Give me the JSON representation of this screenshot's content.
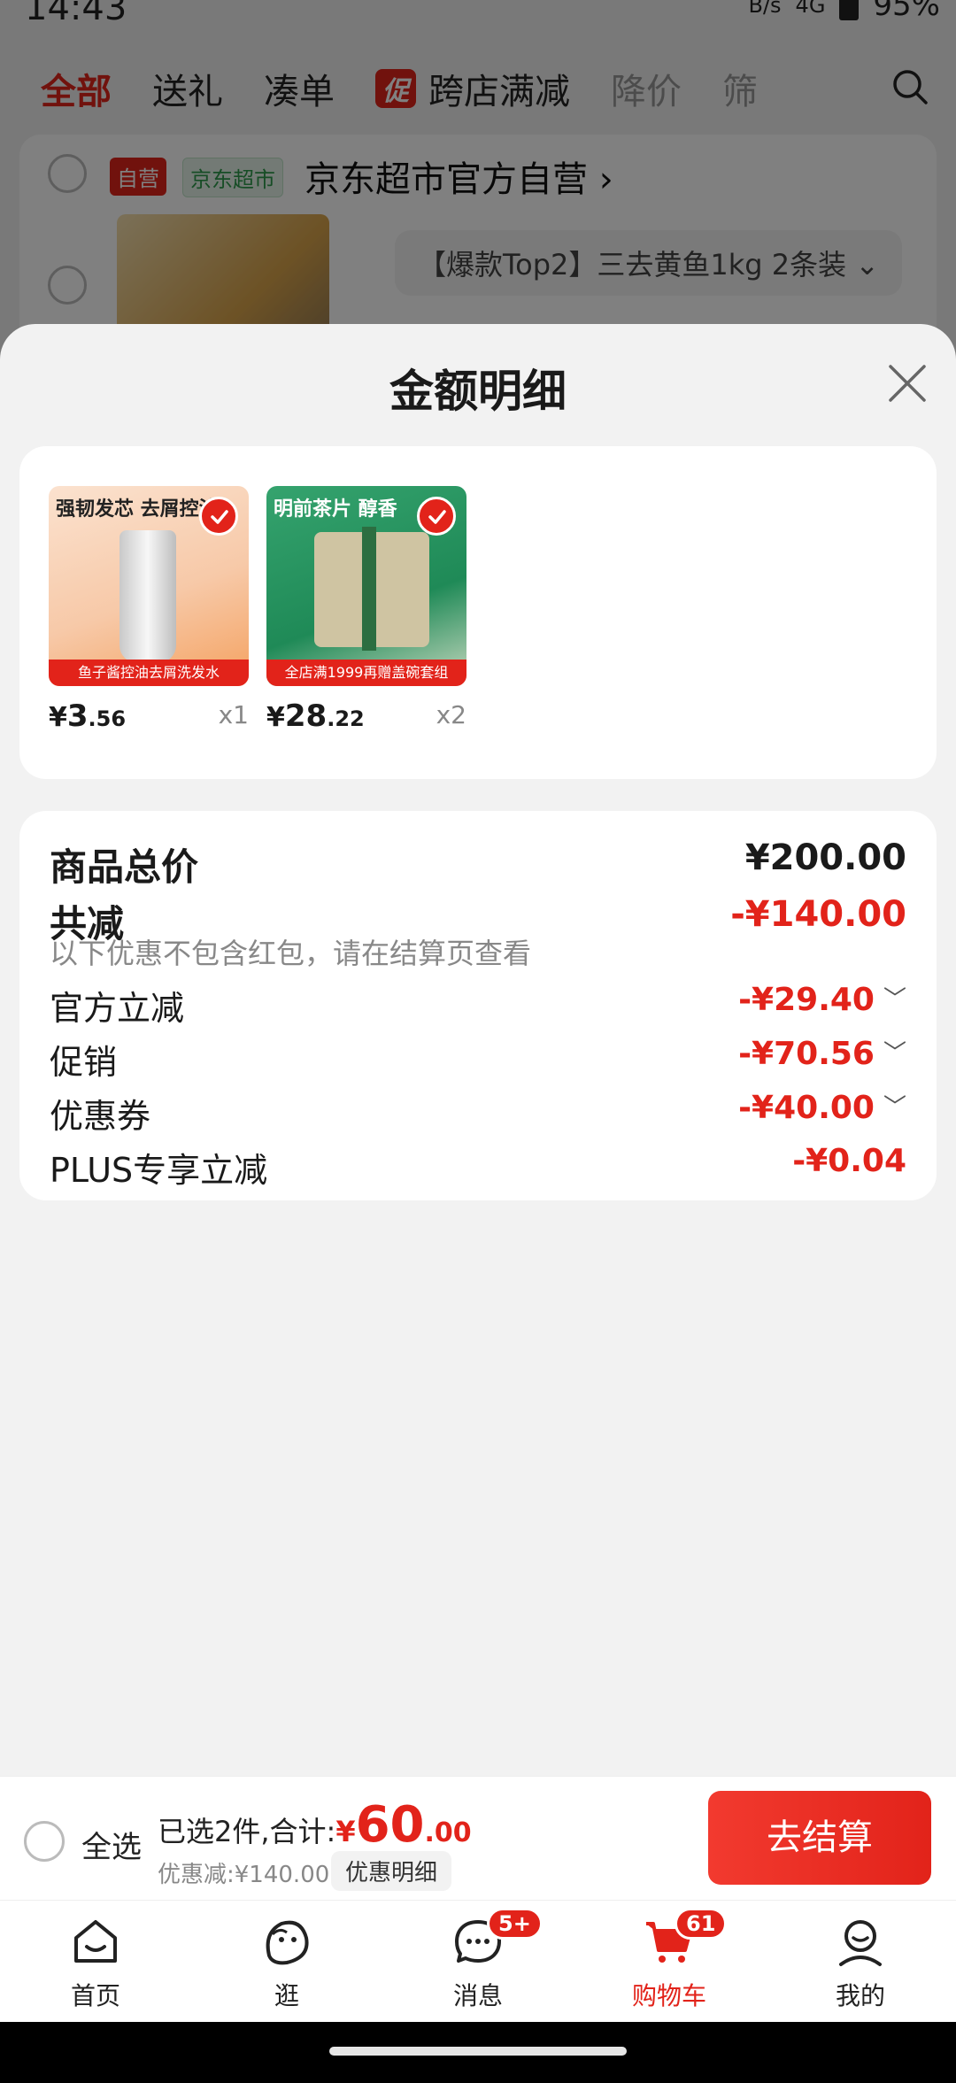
{
  "status_bar": {
    "time": "14:43",
    "net_speed": "B/s",
    "network": "4G",
    "battery": "95%"
  },
  "filter_tabs": [
    {
      "label": "全部"
    },
    {
      "label": "送礼"
    },
    {
      "label": "凑单"
    },
    {
      "badge": "促",
      "label": "跨店满减"
    },
    {
      "label": "降价"
    },
    {
      "label": "筛"
    }
  ],
  "shop": {
    "tag_self": "自营",
    "tag_market": "京东超市",
    "name": "京东超市官方自营 ›",
    "sku_text": "【爆款Top2】三去黄鱼1kg 2条装 ⌄"
  },
  "modal": {
    "title": "金额明细",
    "products": [
      {
        "headline": "强韧发芯 去屑控油",
        "foot_text": "鱼子酱控油去屑洗发水",
        "price_yen": "¥",
        "price_int": "3",
        "price_dec": ".56",
        "qty": "x1"
      },
      {
        "headline": "明前茶片 醇香",
        "foot_text": "全店满1999再赠盖碗套组",
        "price_yen": "¥",
        "price_int": "28",
        "price_dec": ".22",
        "qty": "x2"
      }
    ],
    "summary": {
      "total_label": "商品总价",
      "total_value": "¥200.00",
      "reduce_label": "共减",
      "reduce_value": "-¥140.00",
      "note": "以下优惠不包含红包，请在结算页查看",
      "items": [
        {
          "label": "官方立减",
          "value": "-¥29.40",
          "has_chevron": true
        },
        {
          "label": "促销",
          "value": "-¥70.56",
          "has_chevron": true
        },
        {
          "label": "优惠券",
          "value": "-¥40.00",
          "has_chevron": true
        },
        {
          "label": "PLUS专享立减",
          "value": "-¥0.04",
          "has_chevron": false
        }
      ]
    }
  },
  "settle": {
    "select_all": "全选",
    "selected_prefix": "已选2件,合计:",
    "total_yen": "¥",
    "total_int": "60",
    "total_dec": ".00",
    "discount": "优惠减:¥140.00",
    "detail_chip": "优惠明细",
    "checkout": "去结算"
  },
  "tabbar": [
    {
      "label": "首页",
      "icon": "home-icon"
    },
    {
      "label": "逛",
      "icon": "browse-icon"
    },
    {
      "label": "消息",
      "icon": "message-icon",
      "badge": "5+"
    },
    {
      "label": "购物车",
      "icon": "cart-icon",
      "badge": "61",
      "active": true
    },
    {
      "label": "我的",
      "icon": "profile-icon"
    }
  ],
  "colors": {
    "brand_red": "#e2231a",
    "sheet_bg": "#f2f2f2",
    "dim_overlay": "#7a7a7a"
  }
}
